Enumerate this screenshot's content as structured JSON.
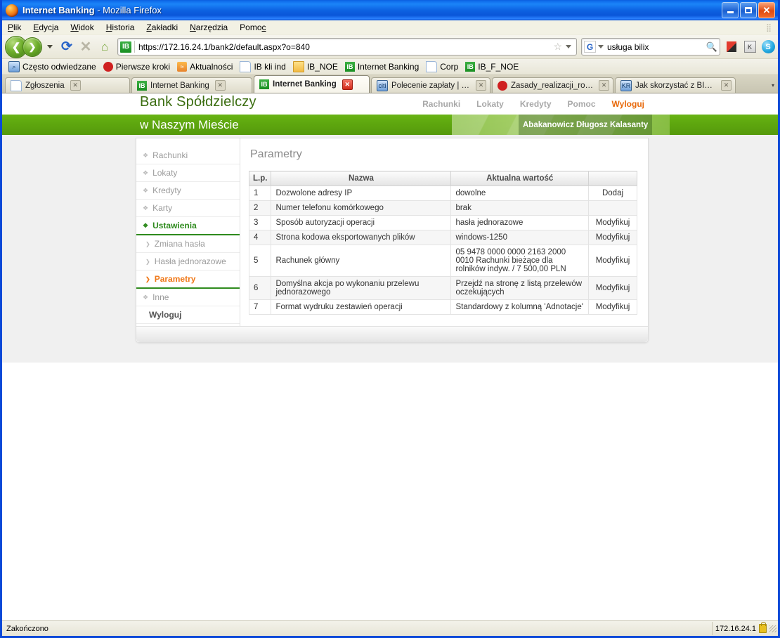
{
  "window": {
    "title_app": "Internet Banking",
    "title_sep": " - Mozilla Firefox",
    "min_label": "",
    "max_label": "",
    "close_label": "✕"
  },
  "menubar": {
    "items": [
      "Plik",
      "Edycja",
      "Widok",
      "Historia",
      "Zakładki",
      "Narzędzia",
      "Pomoc"
    ]
  },
  "toolbar": {
    "back_glyph": "❮",
    "forward_glyph": "❯",
    "reload_glyph": "⟳",
    "stop_glyph": "✕",
    "home_glyph": "⌂",
    "url": "https://172.16.24.1/bank2/default.aspx?o=840",
    "site_icon_label": "IB",
    "star_glyph": "☆",
    "search_engine": "G",
    "search_value": "usługa bilix",
    "search_placeholder": "",
    "search_glyph": "🔍",
    "ext_kav": "K",
    "ext_k": "K",
    "ext_skype": "S"
  },
  "bookmarks": [
    {
      "label": "Często odwiedzane",
      "icon": "history-icon"
    },
    {
      "label": "Pierwsze kroki",
      "icon": "firefox-icon"
    },
    {
      "label": "Aktualności",
      "icon": "rss-icon"
    },
    {
      "label": "IB kli ind",
      "icon": "document-icon"
    },
    {
      "label": "IB_NOE",
      "icon": "folder-icon"
    },
    {
      "label": "Internet Banking",
      "icon": "ib-icon"
    },
    {
      "label": "Corp",
      "icon": "document-icon"
    },
    {
      "label": "IB_F_NOE",
      "icon": "ib-icon"
    }
  ],
  "tabs": [
    {
      "label": "Zgłoszenia",
      "icon": "document-icon",
      "active": false
    },
    {
      "label": "Internet Banking",
      "icon": "ib-icon",
      "active": false
    },
    {
      "label": "Internet Banking",
      "icon": "ib-icon",
      "active": true
    },
    {
      "label": "Polecenie zapłaty | Kont...",
      "icon": "citi-icon",
      "active": false
    },
    {
      "label": "Zasady_realizacji_rozlicz...",
      "icon": "pdf-icon",
      "active": false
    },
    {
      "label": "Jak skorzystać z BILIXA ...",
      "icon": "kir-icon",
      "active": false
    }
  ],
  "tab_close_glyph": "✕",
  "tab_list_glyph": "▾",
  "bank": {
    "name": "Bank Spółdzielczy",
    "subtitle": "w Naszym Mieście",
    "user": "Abakanowicz Długosz Kalasanty",
    "topnav": [
      {
        "label": "Rachunki",
        "active": false
      },
      {
        "label": "Lokaty",
        "active": false
      },
      {
        "label": "Kredyty",
        "active": false
      },
      {
        "label": "Pomoc",
        "active": false
      },
      {
        "label": "Wyloguj",
        "active": true
      }
    ],
    "accent_green": "#5fa80f",
    "accent_orange": "#f07818",
    "link_gray": "#a8a8a8"
  },
  "sidebar": {
    "items": [
      {
        "label": "Rachunki",
        "state": "normal",
        "level": "top",
        "bullet": "❖"
      },
      {
        "label": "Lokaty",
        "state": "normal",
        "level": "top",
        "bullet": "❖"
      },
      {
        "label": "Kredyty",
        "state": "normal",
        "level": "top",
        "bullet": "❖"
      },
      {
        "label": "Karty",
        "state": "normal",
        "level": "top",
        "bullet": "❖"
      },
      {
        "label": "Ustawienia",
        "state": "active-green",
        "level": "top",
        "bullet": "❖"
      },
      {
        "label": "Zmiana hasła",
        "state": "normal",
        "level": "sub",
        "bullet": "❯"
      },
      {
        "label": "Hasła jednorazowe",
        "state": "normal",
        "level": "sub",
        "bullet": "❯"
      },
      {
        "label": "Parametry",
        "state": "active-orange",
        "level": "sub",
        "bullet": "❯"
      },
      {
        "label": "Inne",
        "state": "normal",
        "level": "top",
        "bullet": "❖"
      },
      {
        "label": "Wyloguj",
        "state": "logout",
        "level": "top",
        "bullet": ""
      }
    ]
  },
  "main": {
    "page_title": "Parametry",
    "table": {
      "headers": [
        "L.p.",
        "Nazwa",
        "Aktualna wartość",
        ""
      ],
      "rows": [
        {
          "lp": "1",
          "name": "Dozwolone adresy IP",
          "value": "dowolne",
          "action": "Dodaj"
        },
        {
          "lp": "2",
          "name": "Numer telefonu komórkowego",
          "value": "brak",
          "action": ""
        },
        {
          "lp": "3",
          "name": "Sposób autoryzacji operacji",
          "value": "hasła jednorazowe",
          "action": "Modyfikuj"
        },
        {
          "lp": "4",
          "name": "Strona kodowa eksportowanych plików",
          "value": "windows-1250",
          "action": "Modyfikuj"
        },
        {
          "lp": "5",
          "name": "Rachunek główny",
          "value": "05 9478 0000 0000 2163 2000 0010 Rachunki bieżące dla rolników indyw. / 7 500,00 PLN",
          "action": "Modyfikuj"
        },
        {
          "lp": "6",
          "name": "Domyślna akcja po wykonaniu przelewu jednorazowego",
          "value": "Przejdź na stronę z listą przelewów oczekujących",
          "action": "Modyfikuj"
        },
        {
          "lp": "7",
          "name": "Format wydruku zestawień operacji",
          "value": "Standardowy z kolumną 'Adnotacje'",
          "action": "Modyfikuj"
        }
      ]
    }
  },
  "statusbar": {
    "text": "Zakończono",
    "host": "172.16.24.1"
  }
}
